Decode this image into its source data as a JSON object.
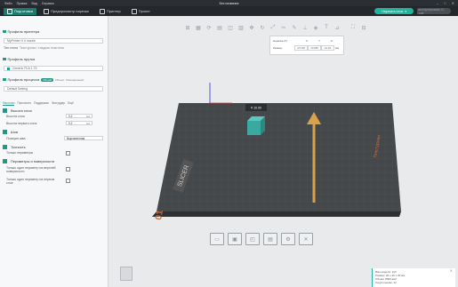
{
  "titlebar": {
    "items": [
      "Файл",
      "Правка",
      "Вид",
      "Справка"
    ],
    "title": "Без названия"
  },
  "menubar": {
    "tabs": [
      {
        "label": "Подготовка",
        "active": true
      },
      {
        "label": "Предпросмотр нарезки",
        "active": false
      },
      {
        "label": "Принтер",
        "active": false
      },
      {
        "label": "Проект",
        "active": false
      }
    ],
    "slice_label": "Нарезать слои",
    "export_label": "Экспортировать G-code"
  },
  "sidebar": {
    "printer_header": "Профиль принтера",
    "printer_value": "MyPrinter 0.4 nozzle",
    "bed_label": "Тип стола",
    "bed_value": "Текстурная / гладкая пластина",
    "filament_header": "Профиль прутка",
    "filament_value": "Generic PLA 1.75",
    "process_header": "Профиль процесса",
    "process_toggle": "Общий",
    "process_extra": "Объект",
    "process_advanced": "Расширенный",
    "process_value": "Default Setting",
    "tabs": [
      "Качество",
      "Прочность",
      "Поддержка",
      "Экструдер",
      "Ещё"
    ],
    "layer_height_header": "Высота слоя",
    "layer_height_label": "Высота слоя",
    "layer_height_value": "0.2",
    "first_layer_label": "Высота первого слоя",
    "first_layer_value": "0.2",
    "unit": "мм",
    "seam_header": "Шов",
    "seam_label": "Позиция шва",
    "seam_value": "Выровненная",
    "precision_header": "Точность",
    "precision_label": "Только периметры",
    "ironing_header": "Периметры и поверхности",
    "ironing_label1": "Только один периметр на верхней поверхности",
    "ironing_label2": "Только один периметр на первом слое"
  },
  "popup": {
    "row1_label": "Нарезка XY",
    "row2_label": "Размер",
    "x_label": "X",
    "y_label": "Y",
    "z_label": "Z",
    "x_value": "171.48",
    "y_value": "174.85",
    "z_value": "12.32",
    "unit": "мм"
  },
  "scene": {
    "object_tag": "# 10.00",
    "bed_brand": "SLICER",
    "plate_number": "01",
    "plate_label": "Текстурная",
    "arrow_color": "#d9a24a",
    "grid_color": "#4a4d50",
    "object_color": "#3aa9a0"
  },
  "info": {
    "line1": "Имя модели: Куб",
    "line2": "Размер: 20 x 20 x 20 мм",
    "line3": "Объём: 8000 мм³",
    "line4": "Треугольники: 12"
  }
}
